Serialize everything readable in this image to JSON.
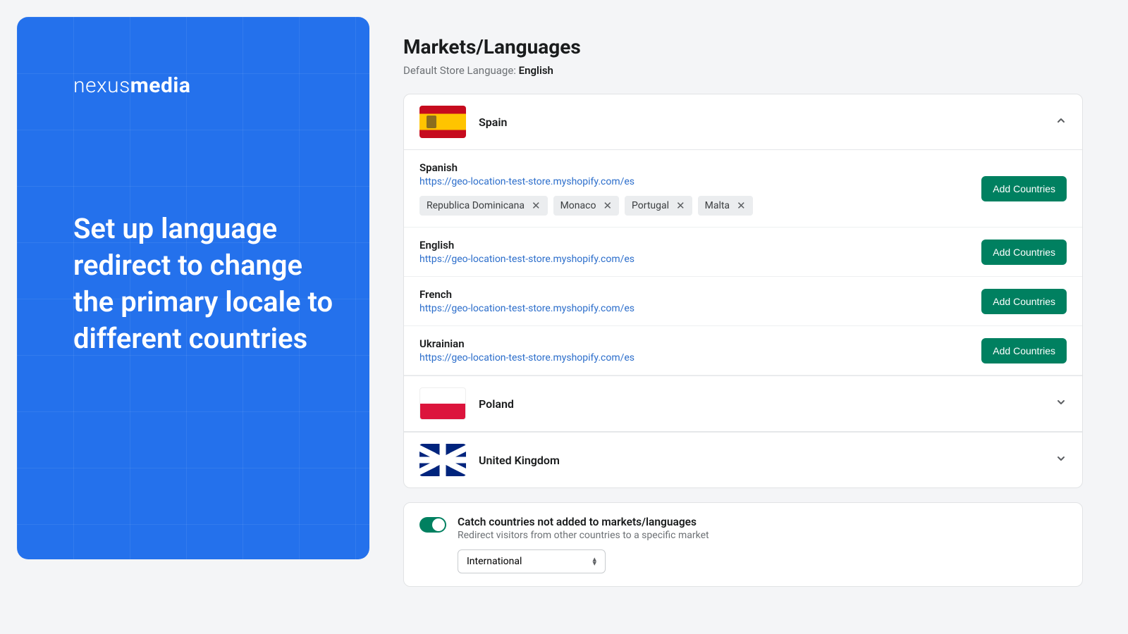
{
  "brand": {
    "light": "nexus",
    "bold": "media"
  },
  "promo_text": "Set up language redirect to change the primary locale to different countries",
  "page": {
    "title": "Markets/Languages",
    "default_label": "Default Store Language: ",
    "default_value": "English"
  },
  "markets": [
    {
      "name": "Spain",
      "flag": "spain",
      "expanded": true,
      "languages": [
        {
          "name": "Spanish",
          "url": "https://geo-location-test-store.myshopify.com/es",
          "countries": [
            "Republica Dominicana",
            "Monaco",
            "Portugal",
            "Malta"
          ],
          "add_label": "Add Countries"
        },
        {
          "name": "English",
          "url": "https://geo-location-test-store.myshopify.com/es",
          "countries": [],
          "add_label": "Add Countries"
        },
        {
          "name": "French",
          "url": "https://geo-location-test-store.myshopify.com/es",
          "countries": [],
          "add_label": "Add Countries"
        },
        {
          "name": "Ukrainian",
          "url": "https://geo-location-test-store.myshopify.com/es",
          "countries": [],
          "add_label": "Add Countries"
        }
      ]
    },
    {
      "name": "Poland",
      "flag": "poland",
      "expanded": false
    },
    {
      "name": "United Kingdom",
      "flag": "uk",
      "expanded": false
    }
  ],
  "catch": {
    "title": "Catch countries not added to markets/languages",
    "subtitle": "Redirect visitors from other countries to a specific market",
    "selected": "International",
    "enabled": true
  }
}
